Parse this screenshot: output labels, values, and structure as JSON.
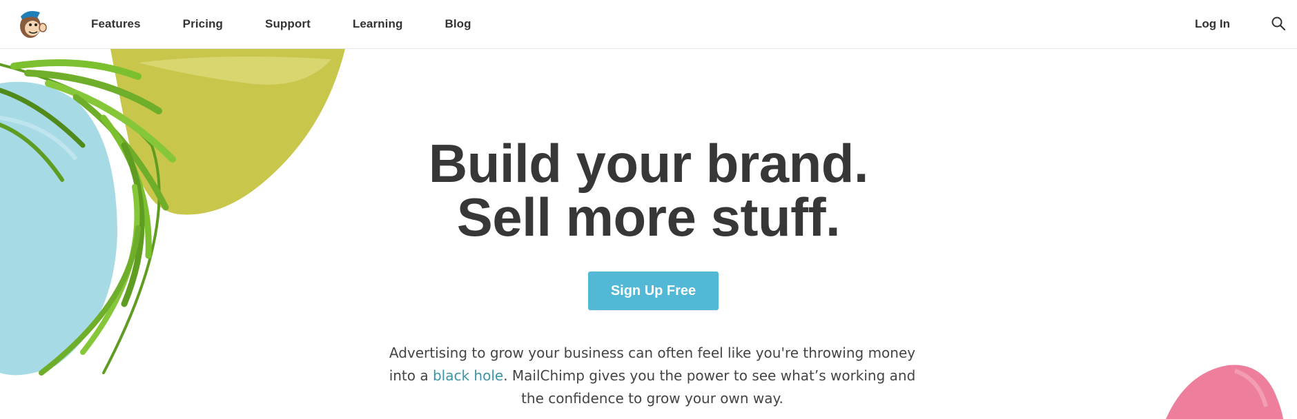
{
  "brand": {
    "logo_icon": "mailchimp-freddie-logo-icon"
  },
  "nav": {
    "items": [
      {
        "label": "Features"
      },
      {
        "label": "Pricing"
      },
      {
        "label": "Support"
      },
      {
        "label": "Learning"
      },
      {
        "label": "Blog"
      }
    ],
    "login_label": "Log In",
    "search_icon": "search-icon"
  },
  "hero": {
    "title_line1": "Build your brand.",
    "title_line2": "Sell more stuff.",
    "cta_label": "Sign Up Free",
    "description_part1": "Advertising to grow your business can often feel like you're throwing money into a ",
    "description_link": "black hole",
    "description_part2": ". MailChimp gives you the power to see what’s working and the confidence to grow your own way."
  },
  "colors": {
    "cta": "#52b8d6",
    "link": "#3a95a6",
    "title": "#373737",
    "olive_shape": "#c7c44a",
    "blue_shape": "#a6dbe6",
    "pink_shape": "#ee7f9c",
    "palm_leaf": "#6fae2a"
  }
}
